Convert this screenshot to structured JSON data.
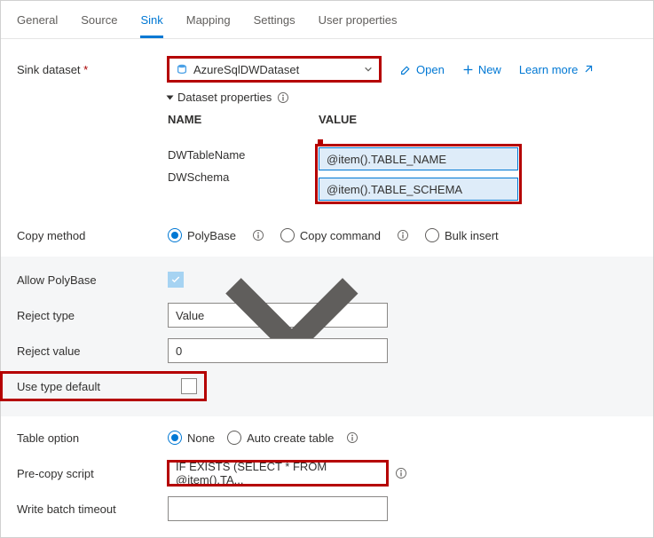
{
  "tabs": {
    "general": "General",
    "source": "Source",
    "sink": "Sink",
    "mapping": "Mapping",
    "settings": "Settings",
    "user_properties": "User properties"
  },
  "labels": {
    "sink_dataset": "Sink dataset",
    "copy_method": "Copy method",
    "allow_polybase": "Allow PolyBase",
    "reject_type": "Reject type",
    "reject_value": "Reject value",
    "use_type_default": "Use type default",
    "table_option": "Table option",
    "precopy_script": "Pre-copy script",
    "write_batch_timeout": "Write batch timeout"
  },
  "dataset": {
    "selected": "AzureSqlDWDataset",
    "open": "Open",
    "new": "New",
    "learn_more": "Learn more"
  },
  "ds_props": {
    "title": "Dataset properties",
    "col_name": "NAME",
    "col_value": "VALUE",
    "rows": [
      {
        "name": "DWTableName",
        "value": "@item().TABLE_NAME"
      },
      {
        "name": "DWSchema",
        "value": "@item().TABLE_SCHEMA"
      }
    ]
  },
  "copy_method": {
    "polybase": "PolyBase",
    "copy_command": "Copy command",
    "bulk_insert": "Bulk insert"
  },
  "polybase": {
    "reject_type_value": "Value",
    "reject_value": "0"
  },
  "table_option": {
    "none": "None",
    "auto_create": "Auto create table"
  },
  "precopy_value": "IF EXISTS (SELECT * FROM  @item().TA...",
  "batch_timeout": ""
}
